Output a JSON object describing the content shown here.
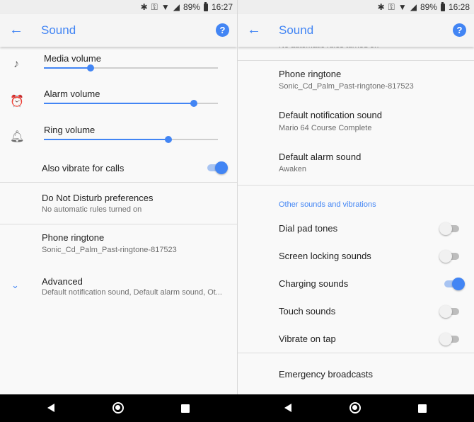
{
  "left": {
    "status": {
      "battery": "89%",
      "time": "16:27"
    },
    "title": "Sound",
    "sliders": [
      {
        "label": "Media volume",
        "icon": "music-note-icon",
        "value": 0.27
      },
      {
        "label": "Alarm volume",
        "icon": "alarm-clock-icon",
        "value": 0.86
      },
      {
        "label": "Ring volume",
        "icon": "bell-icon",
        "value": 0.715
      }
    ],
    "vibrate": {
      "label": "Also vibrate for calls",
      "on": true
    },
    "dnd": {
      "title": "Do Not Disturb preferences",
      "subtitle": "No automatic rules turned on"
    },
    "ringtone": {
      "title": "Phone ringtone",
      "subtitle": "Sonic_Cd_Palm_Past-ringtone-817523"
    },
    "advanced": {
      "title": "Advanced",
      "subtitle": "Default notification sound, Default alarm sound, Ot..."
    }
  },
  "right": {
    "status": {
      "battery": "89%",
      "time": "16:28"
    },
    "title": "Sound",
    "clipped_text": "No automatic rules turned on",
    "ringtone": {
      "title": "Phone ringtone",
      "subtitle": "Sonic_Cd_Palm_Past-ringtone-817523"
    },
    "notification": {
      "title": "Default notification sound",
      "subtitle": "Mario 64 Course Complete"
    },
    "alarm": {
      "title": "Default alarm sound",
      "subtitle": "Awaken"
    },
    "section": "Other sounds and vibrations",
    "toggles": [
      {
        "label": "Dial pad tones",
        "on": false
      },
      {
        "label": "Screen locking sounds",
        "on": false
      },
      {
        "label": "Charging sounds",
        "on": true
      },
      {
        "label": "Touch sounds",
        "on": false
      },
      {
        "label": "Vibrate on tap",
        "on": false
      }
    ],
    "emergency": "Emergency broadcasts"
  },
  "colors": {
    "accent": "#4285f4",
    "background": "#f9f9f9",
    "divider": "#dcdcdc"
  }
}
